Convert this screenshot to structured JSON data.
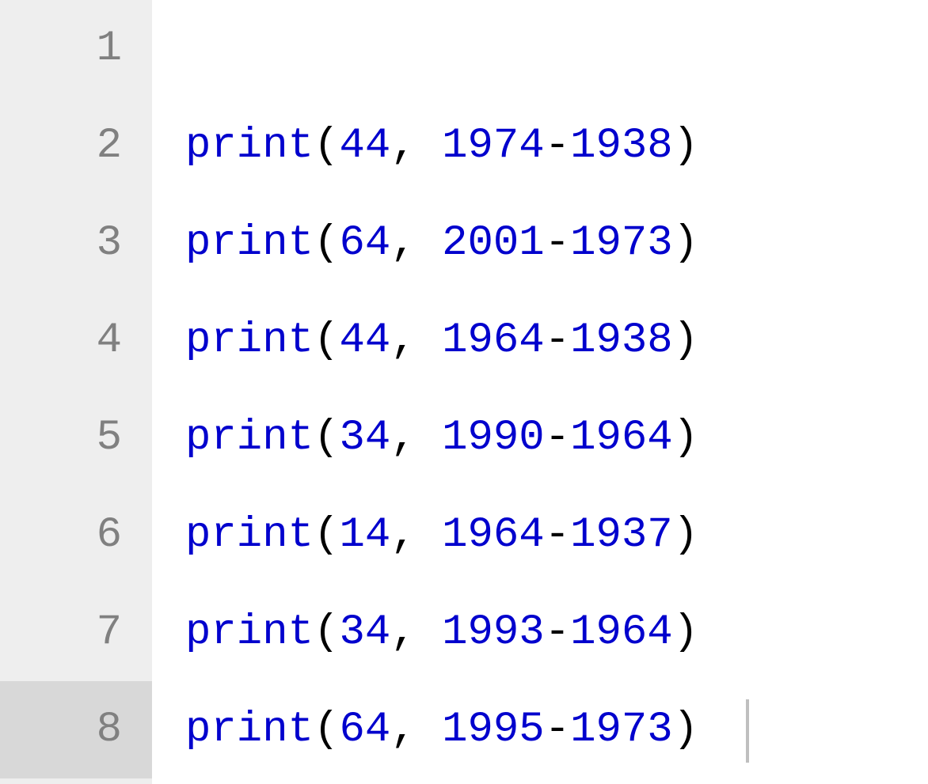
{
  "editor": {
    "current_line_index": 7,
    "caret": {
      "line": 7,
      "col": 15
    },
    "lines": [
      {
        "num": "1",
        "tokens": [],
        "current": false
      },
      {
        "num": "2",
        "tokens": [
          {
            "t": "func",
            "v": "print"
          },
          {
            "t": "punc",
            "v": "("
          },
          {
            "t": "num",
            "v": "44"
          },
          {
            "t": "punc",
            "v": ", "
          },
          {
            "t": "num",
            "v": "1974"
          },
          {
            "t": "punc",
            "v": "-"
          },
          {
            "t": "num",
            "v": "1938"
          },
          {
            "t": "punc",
            "v": ")"
          }
        ],
        "current": false
      },
      {
        "num": "3",
        "tokens": [
          {
            "t": "func",
            "v": "print"
          },
          {
            "t": "punc",
            "v": "("
          },
          {
            "t": "num",
            "v": "64"
          },
          {
            "t": "punc",
            "v": ", "
          },
          {
            "t": "num",
            "v": "2001"
          },
          {
            "t": "punc",
            "v": "-"
          },
          {
            "t": "num",
            "v": "1973"
          },
          {
            "t": "punc",
            "v": ")"
          }
        ],
        "current": false
      },
      {
        "num": "4",
        "tokens": [
          {
            "t": "func",
            "v": "print"
          },
          {
            "t": "punc",
            "v": "("
          },
          {
            "t": "num",
            "v": "44"
          },
          {
            "t": "punc",
            "v": ", "
          },
          {
            "t": "num",
            "v": "1964"
          },
          {
            "t": "punc",
            "v": "-"
          },
          {
            "t": "num",
            "v": "1938"
          },
          {
            "t": "punc",
            "v": ")"
          }
        ],
        "current": false
      },
      {
        "num": "5",
        "tokens": [
          {
            "t": "func",
            "v": "print"
          },
          {
            "t": "punc",
            "v": "("
          },
          {
            "t": "num",
            "v": "34"
          },
          {
            "t": "punc",
            "v": ", "
          },
          {
            "t": "num",
            "v": "1990"
          },
          {
            "t": "punc",
            "v": "-"
          },
          {
            "t": "num",
            "v": "1964"
          },
          {
            "t": "punc",
            "v": ")"
          }
        ],
        "current": false
      },
      {
        "num": "6",
        "tokens": [
          {
            "t": "func",
            "v": "print"
          },
          {
            "t": "punc",
            "v": "("
          },
          {
            "t": "num",
            "v": "14"
          },
          {
            "t": "punc",
            "v": ", "
          },
          {
            "t": "num",
            "v": "1964"
          },
          {
            "t": "punc",
            "v": "-"
          },
          {
            "t": "num",
            "v": "1937"
          },
          {
            "t": "punc",
            "v": ")"
          }
        ],
        "current": false
      },
      {
        "num": "7",
        "tokens": [
          {
            "t": "func",
            "v": "print"
          },
          {
            "t": "punc",
            "v": "("
          },
          {
            "t": "num",
            "v": "34"
          },
          {
            "t": "punc",
            "v": ", "
          },
          {
            "t": "num",
            "v": "1993"
          },
          {
            "t": "punc",
            "v": "-"
          },
          {
            "t": "num",
            "v": "1964"
          },
          {
            "t": "punc",
            "v": ")"
          }
        ],
        "current": false
      },
      {
        "num": "8",
        "tokens": [
          {
            "t": "func",
            "v": "print"
          },
          {
            "t": "punc",
            "v": "("
          },
          {
            "t": "num",
            "v": "64"
          },
          {
            "t": "punc",
            "v": ", "
          },
          {
            "t": "num",
            "v": "1995"
          },
          {
            "t": "punc",
            "v": "-"
          },
          {
            "t": "num",
            "v": "1973"
          },
          {
            "t": "punc",
            "v": ")"
          }
        ],
        "current": true
      }
    ]
  }
}
